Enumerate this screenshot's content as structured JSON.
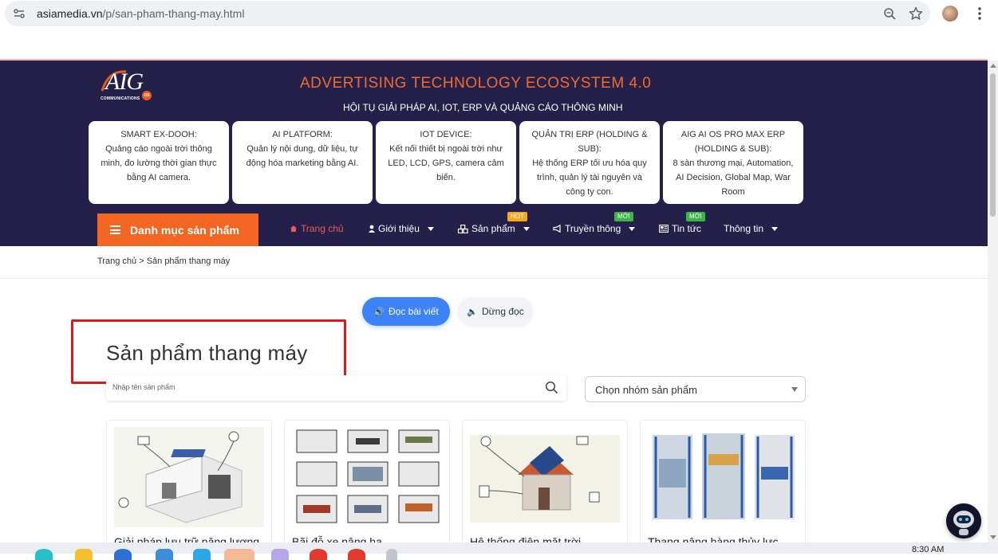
{
  "browser": {
    "url_host": "asiamedia.vn",
    "url_path": "/p/san-pham-thang-may.html"
  },
  "header": {
    "logo_text": "AIG",
    "logo_sub": "COMMUNICATIONS",
    "logo_badge": "OS",
    "title": "ADVERTISING TECHNOLOGY ECOSYSTEM 4.0",
    "subtitle": "HỘI TỤ GIẢI PHÁP AI, IOT, ERP VÀ QUẢNG CÁO THÔNG MINH",
    "cards": [
      {
        "title": "SMART EX-DOOH:",
        "desc": "Quảng cáo ngoài trời thông minh, đo lường thời gian thực bằng AI camera."
      },
      {
        "title": "AI PLATFORM:",
        "desc": "Quản lý nội dung, dữ liệu, tự động hóa marketing bằng AI."
      },
      {
        "title": "IOT DEVICE:",
        "desc": "Kết nối thiết bị ngoài trời như LED, LCD, GPS, camera cảm biến."
      },
      {
        "title": "QUẢN TRỊ ERP (HOLDING & SUB):",
        "desc": "Hệ thống ERP tối ưu hóa quy trình, quản lý tài nguyên và công ty con."
      },
      {
        "title": "AIG AI OS PRO MAX ERP (HOLDING & SUB):",
        "desc": "8 sàn thương mại, Automation, AI Decision, Global Map, War Room"
      }
    ]
  },
  "nav": {
    "menu_label": "Danh mục sản phẩm",
    "items": [
      {
        "label": "Trang chủ",
        "icon": "home-icon"
      },
      {
        "label": "Giới thiệu",
        "icon": "user-icon"
      },
      {
        "label": "Sản phẩm",
        "icon": "cubes-icon",
        "badge": "HOT"
      },
      {
        "label": "Truyền thông",
        "icon": "megaphone-icon",
        "badge": "MỚI"
      },
      {
        "label": "Tin tức",
        "icon": "newspaper-icon",
        "badge": "MỚI"
      },
      {
        "label": "Thông tin"
      }
    ]
  },
  "breadcrumb": {
    "home": "Trang chủ",
    "separator": ">",
    "current": "Sản phẩm thang máy"
  },
  "reader": {
    "read_label": "Đọc bài viết",
    "stop_label": "Dừng đọc"
  },
  "main": {
    "title": "Sản phẩm thang máy",
    "search_placeholder": "Nhập tên sản phẩm",
    "group_select_value": "Chọn nhóm sản phẩm"
  },
  "products": [
    {
      "name": "Giải pháp lưu trữ năng lượng"
    },
    {
      "name": "Bãi đỗ xe nâng hạ"
    },
    {
      "name": "Hệ thống điện mặt trời"
    },
    {
      "name": "Thang nâng hàng thủy lực"
    }
  ],
  "taskbar": {
    "clock": "8:30 AM"
  },
  "colors": {
    "header_bg": "#24204a",
    "accent_orange": "#f26522",
    "read_blue": "#3d83f7",
    "highlight_red": "#e01818"
  }
}
